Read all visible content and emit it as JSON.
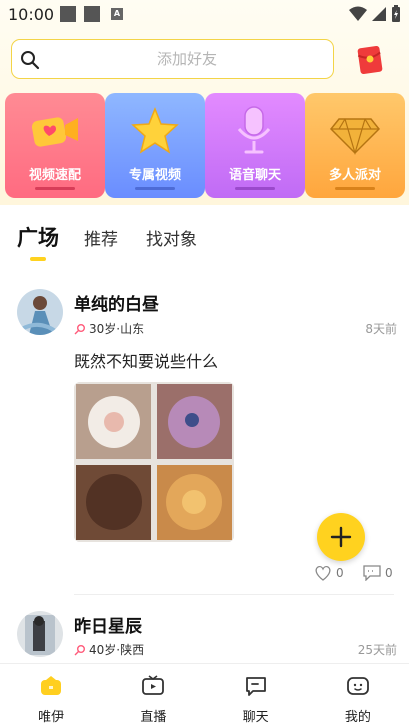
{
  "status_bar": {
    "time": "10:00",
    "notif_letter": "A"
  },
  "search": {
    "placeholder": "添加好友"
  },
  "cards": [
    {
      "label": "视频速配",
      "icon": "video-camera-heart-icon",
      "color_top": "#ff8b94",
      "color_bottom": "#ff6b81"
    },
    {
      "label": "专属视频",
      "icon": "star-icon",
      "color_top": "#8fb7ff",
      "color_bottom": "#6a8dff"
    },
    {
      "label": "语音聊天",
      "icon": "microphone-icon",
      "color_top": "#e38bff",
      "color_bottom": "#c06bf5"
    },
    {
      "label": "多人派对",
      "icon": "diamond-icon",
      "color_top": "#ffc86b",
      "color_bottom": "#ffa63d"
    }
  ],
  "tabs": [
    {
      "label": "广场",
      "active": true
    },
    {
      "label": "推荐",
      "active": false
    },
    {
      "label": "找对象",
      "active": false
    }
  ],
  "posts": [
    {
      "name": "单纯的白昼",
      "meta": "30岁·山东",
      "time": "8天前",
      "text": "既然不知要说些什么",
      "likes": "0",
      "comments": "0"
    },
    {
      "name": "昨日星辰",
      "meta": "40岁·陕西",
      "time": "25天前"
    }
  ],
  "nav": [
    {
      "label": "唯伊",
      "icon": "home-icon",
      "active": true
    },
    {
      "label": "直播",
      "icon": "live-tv-icon",
      "active": false
    },
    {
      "label": "聊天",
      "icon": "chat-bubble-icon",
      "active": false
    },
    {
      "label": "我的",
      "icon": "profile-icon",
      "active": false
    }
  ],
  "colors": {
    "accent": "#ffd21f",
    "search_border": "#f3d447"
  }
}
